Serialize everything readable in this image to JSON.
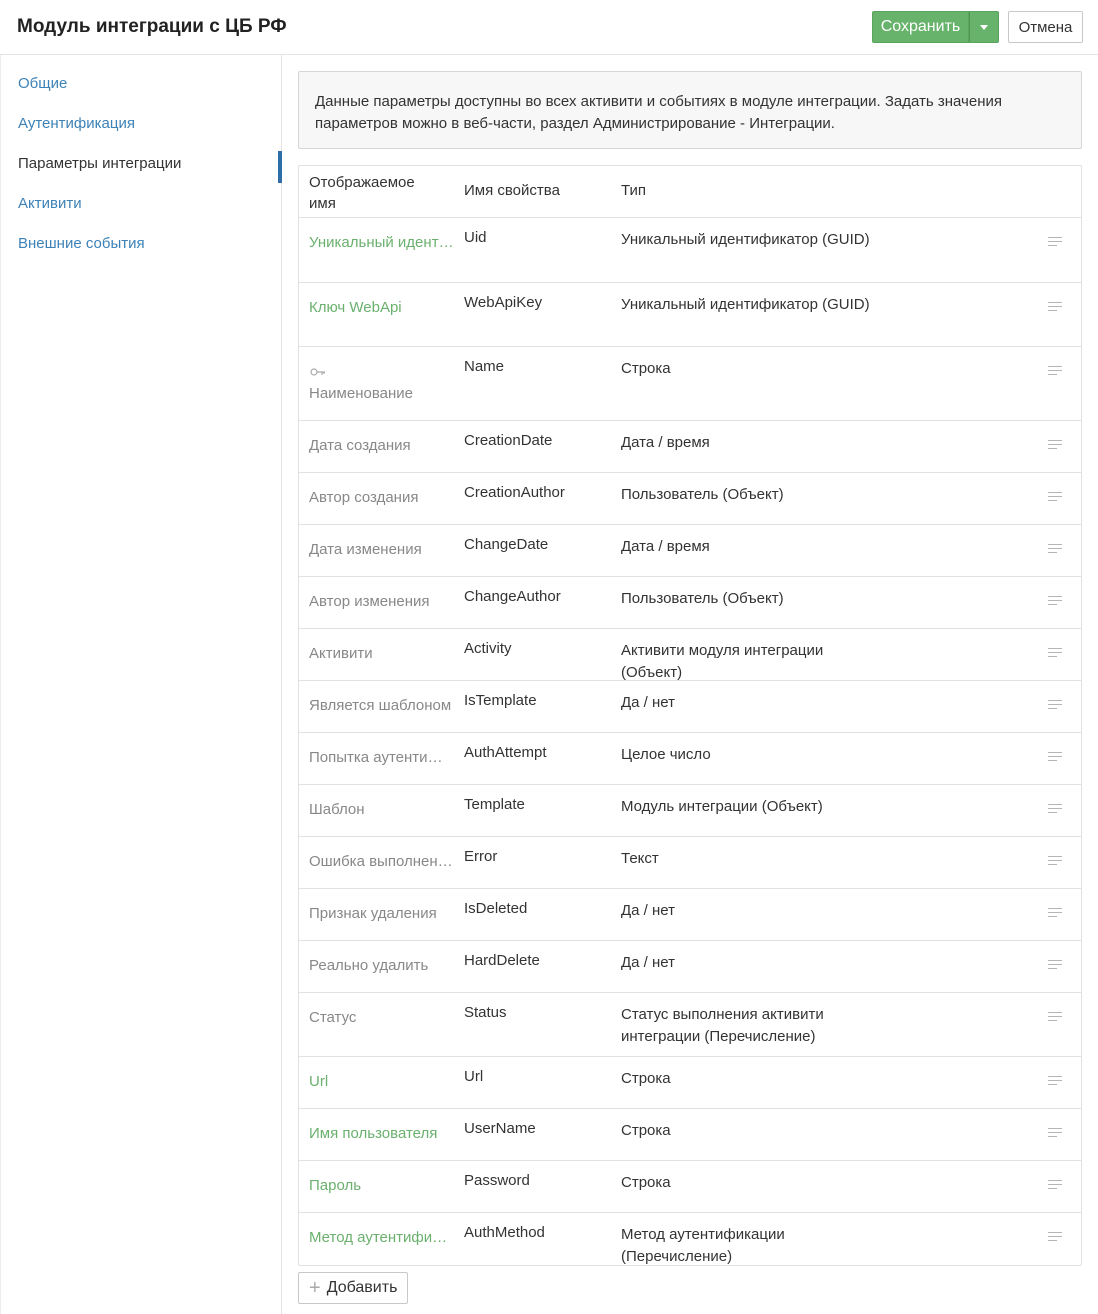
{
  "header": {
    "title": "Модуль интеграции с ЦБ РФ",
    "save_label": "Сохранить",
    "cancel_label": "Отмена"
  },
  "sidebar": {
    "items": [
      {
        "label": "Общие",
        "active": false
      },
      {
        "label": "Аутентификация",
        "active": false
      },
      {
        "label": "Параметры интеграции",
        "active": true
      },
      {
        "label": "Активити",
        "active": false
      },
      {
        "label": "Внешние события",
        "active": false
      }
    ]
  },
  "info": "Данные параметры доступны во всех активити и событиях в модуле интеграции. Задать значения параметров можно в веб-части, раздел Администрирование - Интеграции.",
  "table": {
    "headers": {
      "display": "Отображаемое имя",
      "name": "Имя свойства",
      "type": "Тип"
    },
    "rows": [
      {
        "display": "Уникальный идентификатор",
        "name": "Uid",
        "type": "Уникальный идентификатор (GUID)",
        "custom": true
      },
      {
        "display": "Ключ WebApi",
        "name": "WebApiKey",
        "type": "Уникальный идентификатор (GUID)",
        "custom": true
      },
      {
        "display": "Наименование",
        "name": "Name",
        "type": "Строка",
        "custom": false,
        "key": true
      },
      {
        "display": "Дата создания",
        "name": "CreationDate",
        "type": "Дата / время",
        "custom": false
      },
      {
        "display": "Автор создания",
        "name": "CreationAuthor",
        "type": "Пользователь (Объект)",
        "custom": false
      },
      {
        "display": "Дата изменения",
        "name": "ChangeDate",
        "type": "Дата / время",
        "custom": false
      },
      {
        "display": "Автор изменения",
        "name": "ChangeAuthor",
        "type": "Пользователь (Объект)",
        "custom": false
      },
      {
        "display": "Активити",
        "name": "Activity",
        "type": "Активити модуля интеграции (Объект)",
        "custom": false
      },
      {
        "display": "Является шаблоном",
        "name": "IsTemplate",
        "type": "Да / нет",
        "custom": false
      },
      {
        "display": "Попытка аутентификации",
        "name": "AuthAttempt",
        "type": "Целое число",
        "custom": false
      },
      {
        "display": "Шаблон",
        "name": "Template",
        "type": "Модуль интеграции (Объект)",
        "custom": false
      },
      {
        "display": "Ошибка выполнения",
        "name": "Error",
        "type": "Текст",
        "custom": false
      },
      {
        "display": "Признак удаления",
        "name": "IsDeleted",
        "type": "Да / нет",
        "custom": false
      },
      {
        "display": "Реально удалить",
        "name": "HardDelete",
        "type": "Да / нет",
        "custom": false
      },
      {
        "display": "Статус",
        "name": "Status",
        "type": "Статус выполнения активити интеграции (Перечисление)",
        "custom": false
      },
      {
        "display": "Url",
        "name": "Url",
        "type": "Строка",
        "custom": true
      },
      {
        "display": "Имя пользователя",
        "name": "UserName",
        "type": "Строка",
        "custom": true
      },
      {
        "display": "Пароль",
        "name": "Password",
        "type": "Строка",
        "custom": true
      },
      {
        "display": "Метод аутентификации",
        "name": "AuthMethod",
        "type": "Метод аутентификации (Перечисление)",
        "custom": true
      }
    ]
  },
  "add_label": "Добавить",
  "colors": {
    "accent_green": "#68b36b",
    "link_blue": "#3d82b7",
    "custom_field": "#6bb06e",
    "system_field": "#888888"
  },
  "icons": {
    "row_menu": "row-menu-icon",
    "key": "key-icon",
    "add": "plus-icon",
    "dropdown": "caret-down-icon"
  }
}
